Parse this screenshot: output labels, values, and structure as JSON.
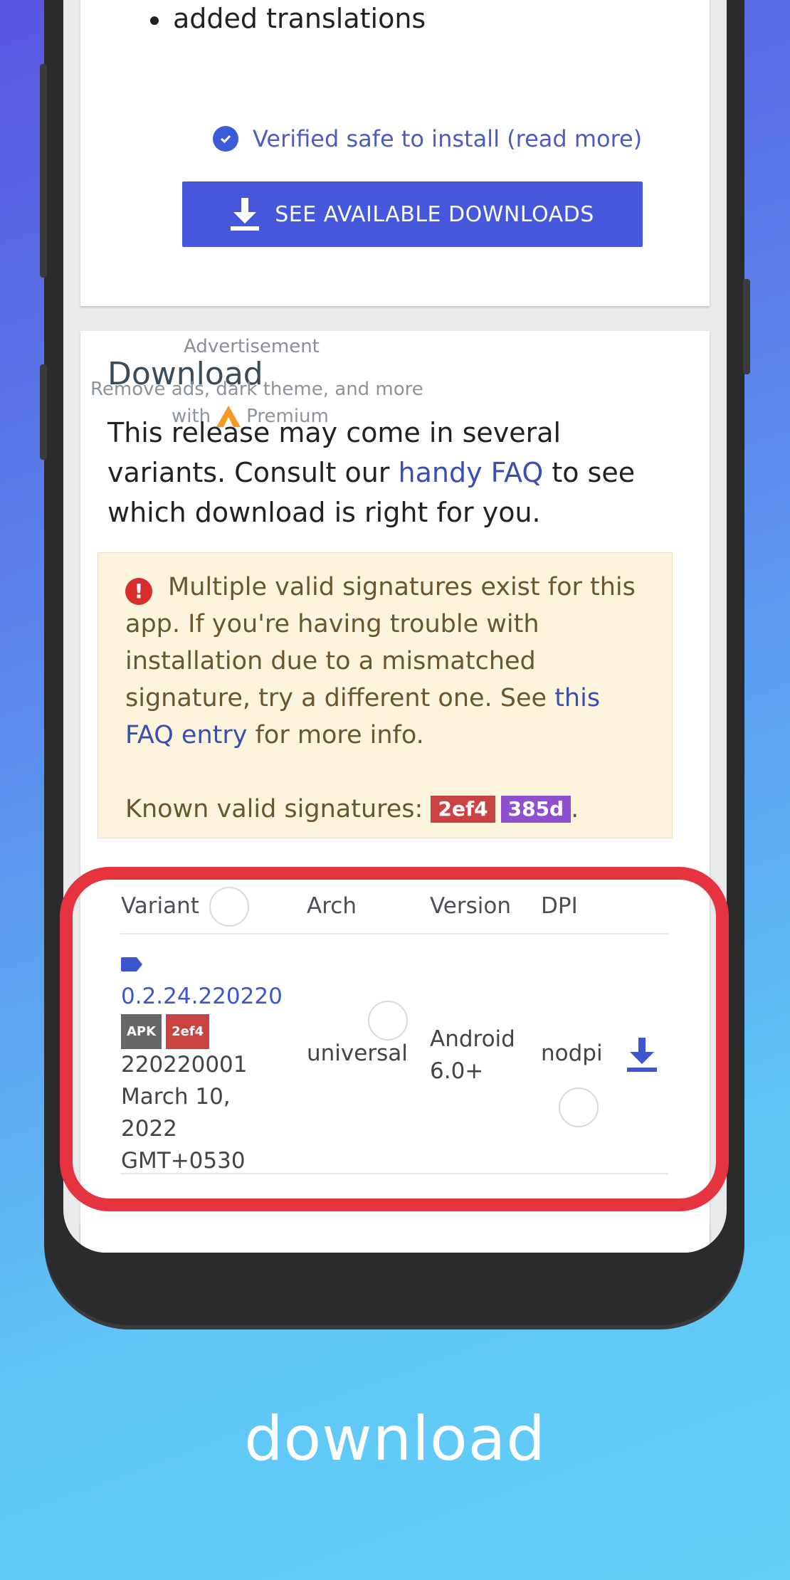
{
  "top_card": {
    "bullet": "added translations",
    "verified_text": "Verified safe to install (read more)",
    "download_button": "SEE AVAILABLE DOWNLOADS"
  },
  "ad": {
    "label": "Advertisement",
    "line1": "Remove ads, dark theme, and more",
    "line2_prefix": "with",
    "line2_suffix": "Premium"
  },
  "download": {
    "title": "Download",
    "intro_1": "This release may come in several variants. Consult our ",
    "intro_link": "handy FAQ",
    "intro_2": " to see which download is right for you."
  },
  "warning": {
    "text_1": "Multiple valid signatures exist for this app. If you're having trouble with installation due to a mismatched signature, try a different one. See ",
    "link": "this FAQ entry",
    "text_2": " for more info.",
    "known_label": "Known valid signatures:",
    "sig1": "2ef4",
    "sig2": "385d",
    "period": "."
  },
  "table": {
    "headers": [
      "Variant",
      "Arch",
      "Version",
      "DPI"
    ],
    "row": {
      "version_name": "0.2.24.220220",
      "badge_apk": "APK",
      "badge_sig": "2ef4",
      "code": "220220001",
      "date1": "March 10,",
      "date2": "2022",
      "tz": "GMT+0530",
      "arch": "universal",
      "android1": "Android",
      "android2": "6.0+",
      "dpi": "nodpi"
    }
  },
  "caption": "download",
  "colors": {
    "accent": "#4558dc",
    "highlight": "#e5333f",
    "warning_bg": "#fcf4dd"
  }
}
